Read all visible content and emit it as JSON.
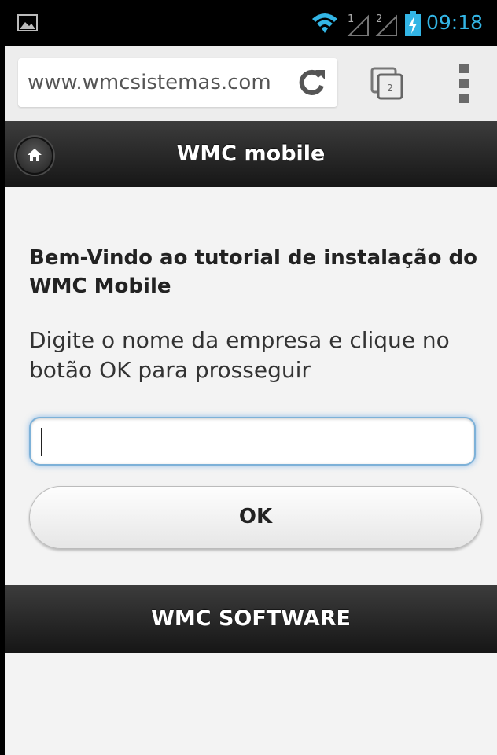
{
  "status_bar": {
    "time": "09:18",
    "signal1_label": "1",
    "signal2_label": "2",
    "time_color": "#33b5e5"
  },
  "browser": {
    "url": "www.wmcsistemas.com",
    "tab_count": "2",
    "icons": [
      "reload-icon",
      "tabs-icon",
      "overflow-menu-icon"
    ]
  },
  "header": {
    "title": "WMC mobile",
    "home_icon": "home-icon"
  },
  "main": {
    "welcome_text": "Bem-Vindo ao tutorial de instalação do WMC Mobile",
    "instructions": "Digite o nome da empresa e clique no botão OK para prosseguir",
    "company_input": {
      "value": "",
      "placeholder": ""
    },
    "ok_button_label": "OK"
  },
  "footer": {
    "text": "WMC SOFTWARE"
  }
}
